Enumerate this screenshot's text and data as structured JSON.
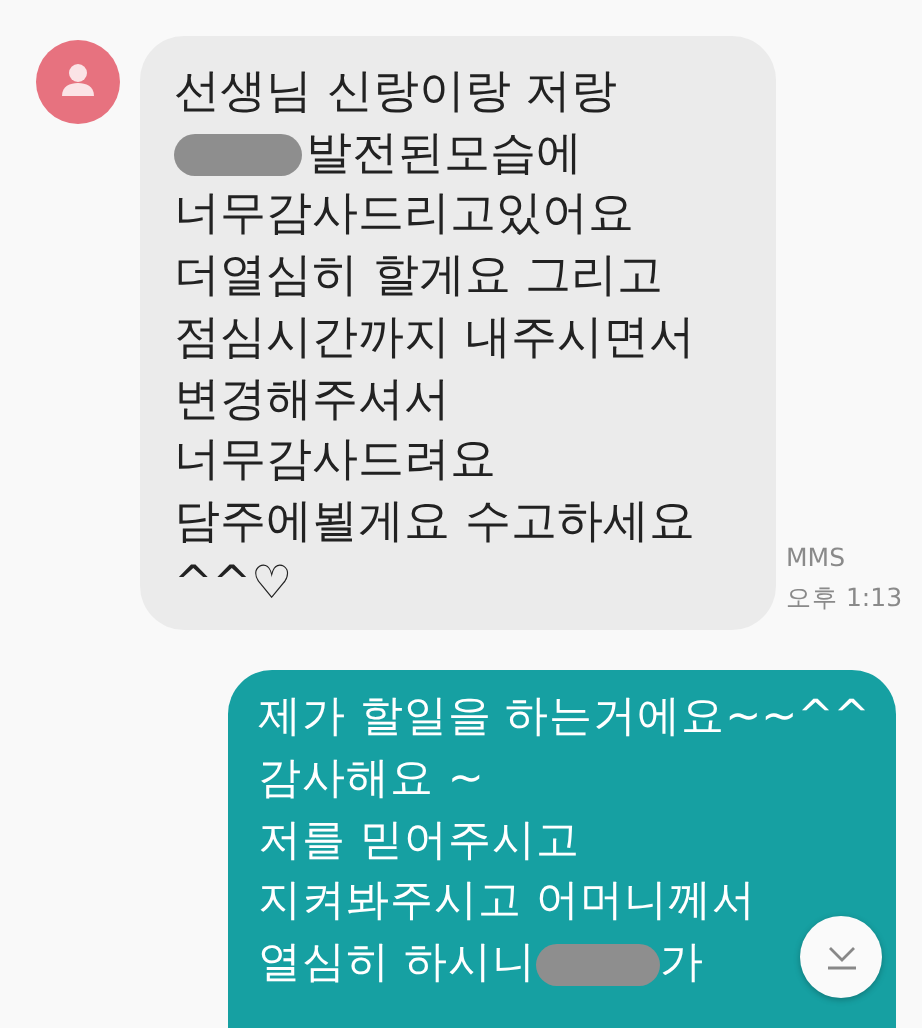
{
  "messages": [
    {
      "kind": "incoming",
      "lines": [
        {
          "segments": [
            {
              "kind": "text",
              "text": "선생님 신랑이랑 저랑"
            }
          ]
        },
        {
          "segments": [
            {
              "kind": "redaction"
            },
            {
              "kind": "text",
              "text": "발전된모습에"
            }
          ]
        },
        {
          "segments": [
            {
              "kind": "text",
              "text": "너무감사드리고있어요"
            }
          ]
        },
        {
          "segments": [
            {
              "kind": "text",
              "text": "더열심히 할게요 그리고"
            }
          ]
        },
        {
          "segments": [
            {
              "kind": "text",
              "text": "점심시간까지 내주시면서"
            }
          ]
        },
        {
          "segments": [
            {
              "kind": "text",
              "text": "변경해주셔서"
            }
          ]
        },
        {
          "segments": [
            {
              "kind": "text",
              "text": "너무감사드려요"
            }
          ]
        },
        {
          "segments": [
            {
              "kind": "text",
              "text": "담주에뵐게요 수고하세요"
            }
          ]
        },
        {
          "segments": [
            {
              "kind": "text",
              "text": "^^♡"
            }
          ]
        }
      ],
      "type": "MMS",
      "time": "오후 1:13"
    },
    {
      "kind": "outgoing",
      "lines": [
        {
          "segments": [
            {
              "kind": "text",
              "text": "제가 할일을 하는거에요~~^^"
            }
          ]
        },
        {
          "segments": [
            {
              "kind": "text",
              "text": "감사해요 ~"
            }
          ]
        },
        {
          "segments": [
            {
              "kind": "text",
              "text": "저를 믿어주시고"
            }
          ]
        },
        {
          "segments": [
            {
              "kind": "text",
              "text": "지켜봐주시고 어머니께서"
            }
          ]
        },
        {
          "segments": [
            {
              "kind": "text",
              "text": "열심히 하시니 "
            },
            {
              "kind": "redaction"
            },
            {
              "kind": "text",
              "text": "가"
            }
          ]
        }
      ]
    }
  ]
}
